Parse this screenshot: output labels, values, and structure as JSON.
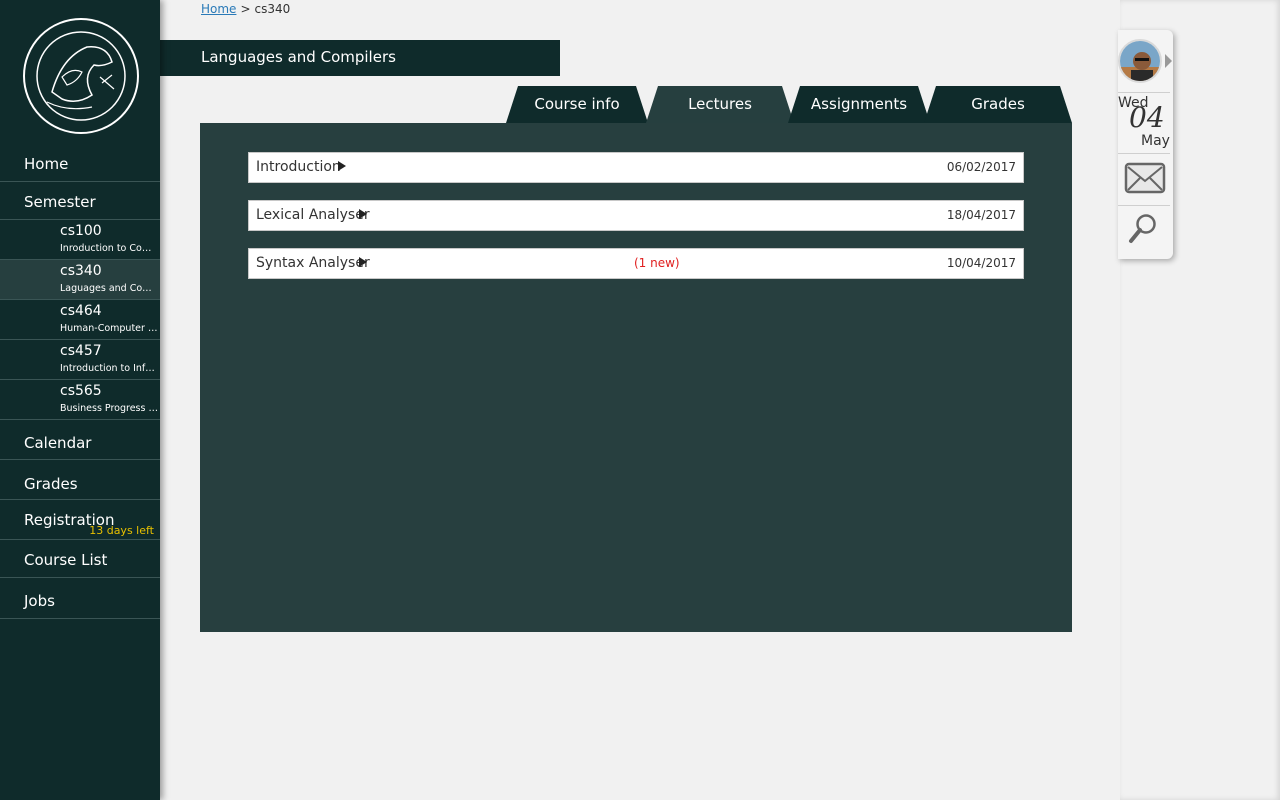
{
  "sidebar": {
    "nav_top": [
      {
        "label": "Home"
      },
      {
        "label": "Semester"
      }
    ],
    "semester_courses": [
      {
        "code": "cs100",
        "title": "Inroduction to Comp..."
      },
      {
        "code": "cs340",
        "title": "Laguages and Compi..."
      },
      {
        "code": "cs464",
        "title": "Human-Computer In..."
      },
      {
        "code": "cs457",
        "title": "Introduction to Infor..."
      },
      {
        "code": "cs565",
        "title": "Business Progress M..."
      }
    ],
    "nav_bottom": [
      {
        "label": "Calendar"
      },
      {
        "label": "Grades"
      },
      {
        "label": "Registration",
        "note": "13 days left"
      },
      {
        "label": "Course List"
      },
      {
        "label": "Jobs"
      }
    ]
  },
  "breadcrumb": {
    "home": "Home",
    "separator": ">",
    "current": "cs340"
  },
  "course_title": "Languages and Compilers",
  "tabs": [
    {
      "label": "Course info"
    },
    {
      "label": "Lectures"
    },
    {
      "label": "Assignments"
    },
    {
      "label": "Grades"
    }
  ],
  "active_tab": "Lectures",
  "lectures": [
    {
      "name": "Introduction",
      "date": "06/02/2017",
      "new": ""
    },
    {
      "name": "Lexical Analyser",
      "date": "18/04/2017",
      "new": ""
    },
    {
      "name": "Syntax Analyser",
      "date": "10/04/2017",
      "new": "(1 new)"
    }
  ],
  "right_panel": {
    "day": "Wed",
    "date": "04",
    "month": "May"
  },
  "colors": {
    "sidebar_bg": "#0f2b2b",
    "content_bg": "#273f3f",
    "notice_yellow": "#e8c000",
    "new_red": "#e02020",
    "link_blue": "#2a7ab8"
  }
}
